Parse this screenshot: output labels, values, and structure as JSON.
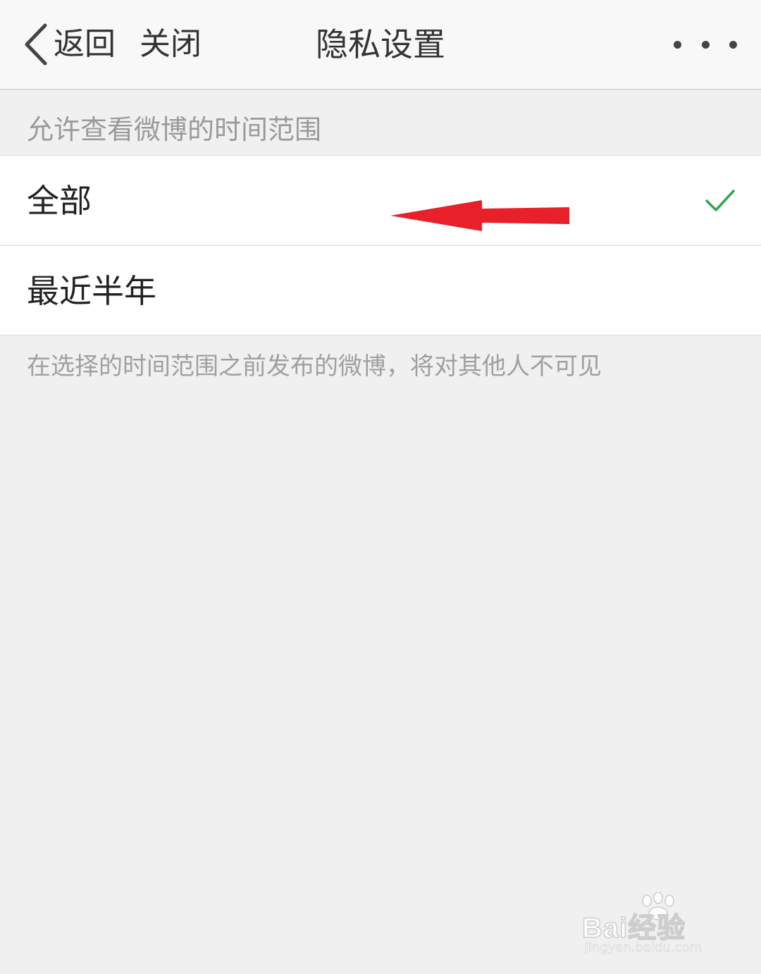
{
  "header": {
    "back_label": "返回",
    "close_label": "关闭",
    "title": "隐私设置"
  },
  "section": {
    "title": "允许查看微博的时间范围"
  },
  "options": [
    {
      "label": "全部",
      "selected": true
    },
    {
      "label": "最近半年",
      "selected": false
    }
  ],
  "note": "在选择的时间范围之前发布的微博，将对其他人不可见",
  "colors": {
    "check": "#2fa84f",
    "annotation_arrow": "#e8202a"
  },
  "watermark": {
    "brand": "Bai经验",
    "url": "jingyan.baidu.com"
  }
}
